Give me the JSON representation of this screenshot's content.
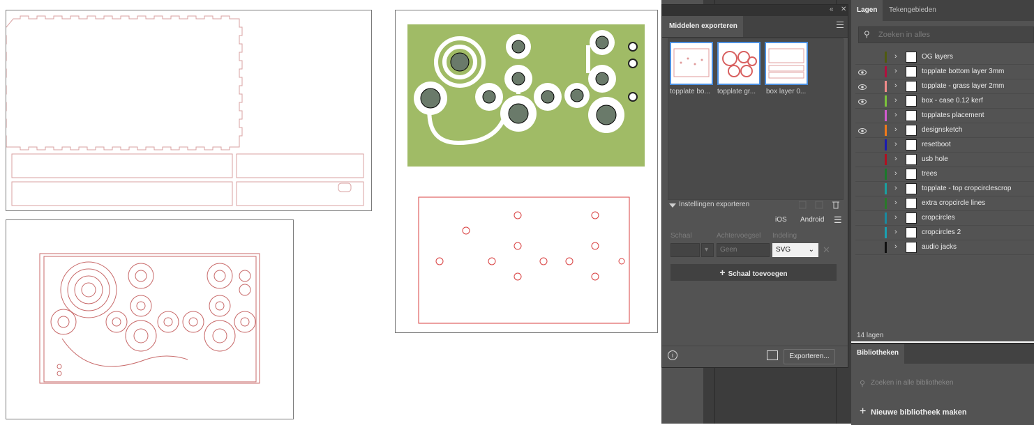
{
  "export_panel": {
    "collapse_icon": "double-chevron-icon",
    "close_icon": "close-icon",
    "tab_label": "Middelen exporteren",
    "assets": [
      {
        "label": "topplate bo..."
      },
      {
        "label": "topplate gr..."
      },
      {
        "label": "box layer 0..."
      }
    ],
    "settings_label": "Instellingen exporteren",
    "platform_ios": "iOS",
    "platform_android": "Android",
    "col_scale": "Schaal",
    "col_suffix": "Achtervoegsel",
    "col_format": "Indeling",
    "suffix_placeholder": "Geen",
    "format_value": "SVG",
    "add_scale_label": "Schaal toevoegen",
    "export_button": "Exporteren..."
  },
  "layers_panel": {
    "tabs": [
      "Lagen",
      "Tekengebieden"
    ],
    "active_tab": "Lagen",
    "search_placeholder": "Zoeken in alles",
    "layers": [
      {
        "name": "OG layers",
        "visible": false,
        "color": "#4f5a10"
      },
      {
        "name": "topplate bottom layer 3mm",
        "visible": true,
        "color": "#b0103e"
      },
      {
        "name": "topplate - grass layer 2mm",
        "visible": true,
        "color": "#f08a8a"
      },
      {
        "name": "box - case 0.12 kerf",
        "visible": true,
        "color": "#7bc43b"
      },
      {
        "name": "topplates placement",
        "visible": false,
        "color": "#d35ad0"
      },
      {
        "name": "designsketch",
        "visible": true,
        "color": "#f07a1a"
      },
      {
        "name": "resetboot",
        "visible": false,
        "color": "#1a1ab0"
      },
      {
        "name": "usb hole",
        "visible": false,
        "color": "#b01020"
      },
      {
        "name": "trees",
        "visible": false,
        "color": "#1a7a2a"
      },
      {
        "name": "topplate - top cropcirclescrop",
        "visible": false,
        "color": "#1aa0a0"
      },
      {
        "name": "extra cropcircle lines",
        "visible": false,
        "color": "#2a7a2a"
      },
      {
        "name": "cropcircles",
        "visible": false,
        "color": "#1a8aa0"
      },
      {
        "name": "cropcircles 2",
        "visible": false,
        "color": "#1aa0b0"
      },
      {
        "name": "audio jacks",
        "visible": false,
        "color": "#111111"
      }
    ],
    "count_label": "14 lagen"
  },
  "libraries_panel": {
    "tab_label": "Bibliotheken",
    "search_placeholder": "Zoeken in alle bibliotheken",
    "new_library": "Nieuwe bibliotheek maken"
  },
  "colors": {
    "grass": "#a0bb66",
    "hole": "#6a7a6a",
    "cut_line": "#c0392b",
    "accent_select": "#4b8fe0"
  }
}
